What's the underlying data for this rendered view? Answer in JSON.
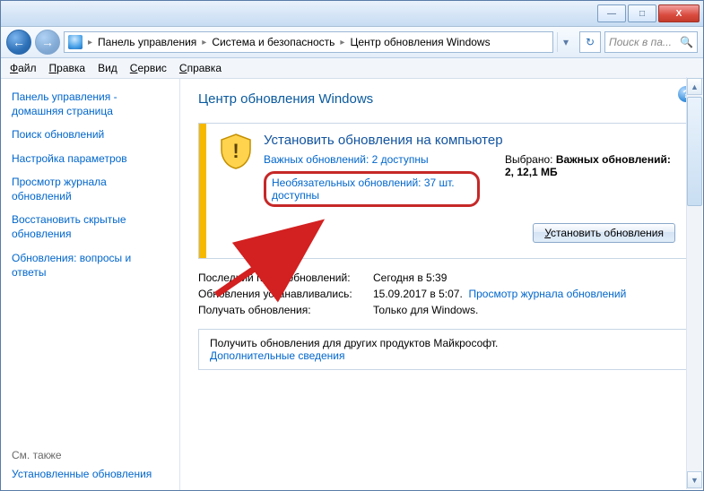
{
  "titlebar": {
    "min_label": "—",
    "max_label": "□",
    "close_label": "X"
  },
  "nav": {
    "back_glyph": "←",
    "fwd_glyph": "→",
    "dropdown_glyph": "▾",
    "refresh_glyph": "↻",
    "search_placeholder": "Поиск в па...",
    "search_icon": "🔍"
  },
  "breadcrumbs": {
    "sep": "▸",
    "items": [
      "Панель управления",
      "Система и безопасность",
      "Центр обновления Windows"
    ]
  },
  "menu": {
    "file": {
      "u": "Ф",
      "rest": "айл"
    },
    "edit": {
      "u": "П",
      "rest": "равка"
    },
    "view": {
      "pre": "Ви",
      "u": "д"
    },
    "tools": {
      "u": "С",
      "rest": "ервис"
    },
    "help": {
      "u": "С",
      "rest": "правка"
    }
  },
  "sidebar": {
    "items": [
      "Панель управления - домашняя страница",
      "Поиск обновлений",
      "Настройка параметров",
      "Просмотр журнала обновлений",
      "Восстановить скрытые обновления",
      "Обновления: вопросы и ответы"
    ],
    "see_also_heading": "См. также",
    "see_also_link": "Установленные обновления"
  },
  "main": {
    "title": "Центр обновления Windows",
    "help_glyph": "?",
    "panel": {
      "heading": "Установить обновления на компьютер",
      "important_link": "Важных обновлений: 2 доступны",
      "optional_link": "Необязательных обновлений: 37 шт. доступны",
      "selected_label": "Выбрано: ",
      "selected_value": "Важных обновлений: 2, 12,1 МБ",
      "install_pre": "",
      "install_u": "У",
      "install_rest": "становить обновления"
    },
    "info": {
      "last_check_label": "Последний поиск обновлений:",
      "last_check_value": "Сегодня в 5:39",
      "installed_label": "Обновления устанавливались:",
      "installed_value": "15.09.2017 в 5:07.",
      "installed_link": "Просмотр журнала обновлений",
      "receive_label": "Получать обновления:",
      "receive_value": "Только для Windows."
    },
    "bottom": {
      "text": "Получить обновления для других продуктов Майкрософт.",
      "link": "Дополнительные сведения"
    }
  },
  "scroll": {
    "up": "▲",
    "down": "▼"
  }
}
